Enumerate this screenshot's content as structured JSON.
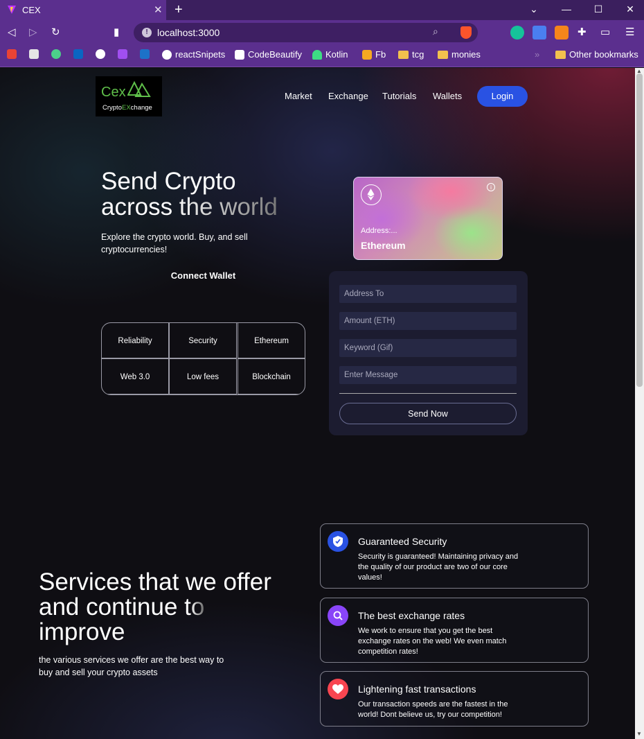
{
  "browser": {
    "tab_title": "CEX",
    "url": "localhost:3000",
    "bookmarks": [
      {
        "label": "reactSnipets"
      },
      {
        "label": "CodeBeautify"
      },
      {
        "label": "Kotlin"
      },
      {
        "label": "Fb"
      },
      {
        "label": "tcg"
      },
      {
        "label": "monies"
      },
      {
        "label": "Other bookmarks"
      }
    ]
  },
  "header": {
    "logo_text": "Cex",
    "logo_sub_a": "Crypto",
    "logo_sub_b": "EX",
    "logo_sub_c": "change",
    "nav": [
      "Market",
      "Exchange",
      "Tutorials",
      "Wallets"
    ],
    "login_label": "Login"
  },
  "hero": {
    "title_line1": "Send Crypto",
    "title_line2": "across the world",
    "subtitle": "Explore the crypto world. Buy, and sell cryptocurrencies!",
    "connect_label": "Connect Wallet",
    "features": [
      "Reliability",
      "Security",
      "Ethereum",
      "Web 3.0",
      "Low fees",
      "Blockchain"
    ]
  },
  "card": {
    "address_label": "Address:...",
    "network": "Ethereum",
    "info_glyph": "i"
  },
  "form": {
    "address_placeholder": "Address To",
    "amount_placeholder": "Amount (ETH)",
    "keyword_placeholder": "Keyword (Gif)",
    "message_placeholder": "Enter Message",
    "send_label": "Send Now"
  },
  "services": {
    "title_line1": "Services that we offer",
    "title_line2a": "and continue ",
    "title_line2b": "to",
    "title_line3": "improve",
    "subtitle": "the various services we offer are the best way to buy and sell your crypto assets",
    "items": [
      {
        "title": "Guaranteed Security",
        "desc": "Security is guaranteed! Maintaining privacy and the quality of our product are two of our core values!",
        "color": "#2952e3",
        "icon": "shield-icon"
      },
      {
        "title": "The best exchange rates",
        "desc": "We work to ensure that you get the best exchange rates on the web! We even match competition rates!",
        "color": "#8945f8",
        "icon": "search-icon"
      },
      {
        "title": "Lightening fast transactions",
        "desc": "Our transaction speeds are the fastest in the world! Dont believe us, try our competition!",
        "color": "#f84550",
        "icon": "heart-icon"
      }
    ]
  }
}
